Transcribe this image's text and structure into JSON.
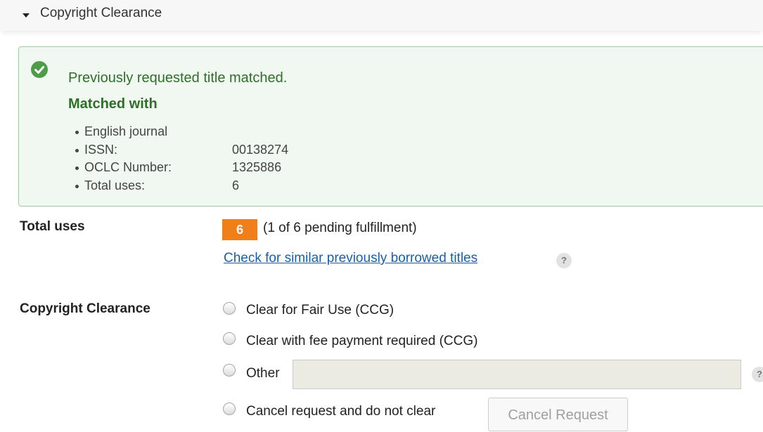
{
  "section": {
    "title": "Copyright Clearance",
    "caret_icon": "caret-down-icon"
  },
  "alert": {
    "icon": "check-circle-icon",
    "message": "Previously requested title matched.",
    "matched_title": "Matched with",
    "items": [
      {
        "label": "English journal",
        "value": ""
      },
      {
        "label": "ISSN:",
        "value": "00138274"
      },
      {
        "label": "OCLC Number:",
        "value": "1325886"
      },
      {
        "label": "Total uses:",
        "value": "6"
      }
    ],
    "colors": {
      "border": "#9fcd9f",
      "background": "#f1f8f1",
      "text": "#2f6f2a",
      "icon": "#4f9c48"
    }
  },
  "total_uses": {
    "label": "Total uses",
    "count": "6",
    "pending_text": "(1 of 6 pending fulfillment)",
    "badge_color": "#f07f1a",
    "similar_link": "Check for similar previously borrowed titles",
    "help": "?"
  },
  "copyright_clearance": {
    "label": "Copyright Clearance",
    "options": [
      {
        "label": "Clear for Fair Use (CCG)",
        "selected": false
      },
      {
        "label": "Clear with fee payment required (CCG)",
        "selected": false
      },
      {
        "label": "Other",
        "selected": false
      },
      {
        "label": "Cancel request and do not clear",
        "selected": false
      }
    ],
    "other_value": "",
    "other_help": "?",
    "cancel_button": "Cancel Request",
    "link_color": "#1c5ea8"
  }
}
